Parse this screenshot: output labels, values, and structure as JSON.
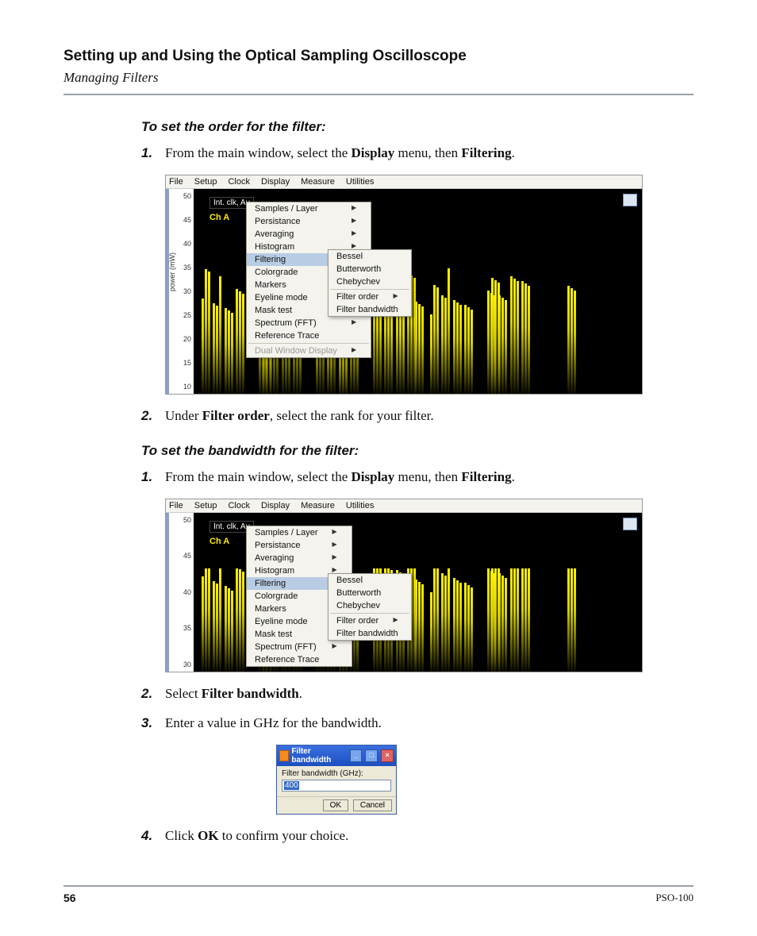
{
  "chapter_title": "Setting up and Using the Optical Sampling Oscilloscope",
  "section_subtitle": "Managing Filters",
  "sub1": "To set the order for the filter:",
  "sub2": "To set the bandwidth for the filter:",
  "step_main_window_pre": "From the main window, select the ",
  "step_main_window_mid": " menu, then ",
  "display_word": "Display",
  "filtering_word": "Filtering",
  "period": ".",
  "step_order_pre": "Under ",
  "step_order_bold": "Filter order",
  "step_order_post": ", select the rank for your filter.",
  "step_bw_sel_pre": "Select ",
  "step_bw_sel_bold": "Filter bandwidth",
  "step_ghz": "Enter a value in GHz for the bandwidth.",
  "step_ok_pre": "Click ",
  "step_ok_bold": "OK",
  "step_ok_post": " to confirm your choice.",
  "num1": "1.",
  "num2": "2.",
  "num3": "3.",
  "num4": "4.",
  "menubar": [
    "File",
    "Setup",
    "Clock",
    "Display",
    "Measure",
    "Utilities"
  ],
  "display_menu": {
    "items": [
      {
        "label": "Samples / Layer",
        "sub": true
      },
      {
        "label": "Persistance",
        "sub": true
      },
      {
        "label": "Averaging",
        "sub": true
      },
      {
        "label": "Histogram",
        "sub": true
      },
      {
        "label": "Filtering",
        "sub": true,
        "hi": true
      },
      {
        "label": "Colorgrade",
        "sub": true
      },
      {
        "label": "Markers",
        "sub": true
      },
      {
        "label": "Eyeline mode",
        "sub": true
      },
      {
        "label": "Mask test",
        "sub": true
      },
      {
        "label": "Spectrum (FFT)",
        "sub": true
      },
      {
        "label": "Reference Trace",
        "sub": false
      },
      {
        "label": "Dual Window Display",
        "sub": true,
        "dis": true
      }
    ]
  },
  "filtering_submenu": [
    "Bessel",
    "Butterworth",
    "Chebychev"
  ],
  "filtering_submenu2": [
    {
      "label": "Filter order",
      "sub": true
    },
    {
      "label": "Filter bandwidth",
      "sub": false
    }
  ],
  "yticks_full": [
    "50",
    "45",
    "40",
    "35",
    "30",
    "25",
    "20",
    "15",
    "10"
  ],
  "yticks_short": [
    "50",
    "45",
    "40",
    "35",
    "30"
  ],
  "ylabel": "power (mW)",
  "plot_label_white": "Int. clk, Au",
  "plot_label_yellow": "Ch A",
  "dialog": {
    "title": "Filter bandwidth",
    "label": "Filter bandwidth (GHz):",
    "value": "400",
    "ok": "OK",
    "cancel": "Cancel"
  },
  "footer": {
    "page": "56",
    "model": "PSO-100"
  }
}
